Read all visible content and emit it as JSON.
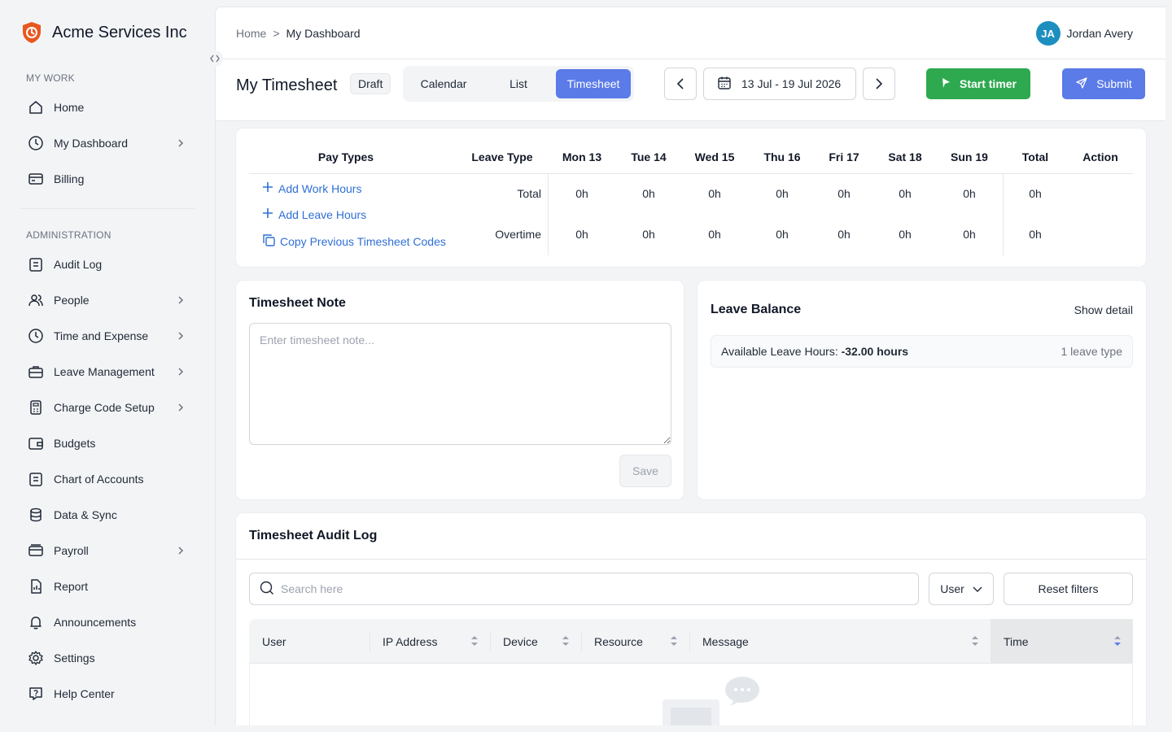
{
  "brand": {
    "name": "Acme Services Inc"
  },
  "sidebar": {
    "sections": [
      {
        "title": "MY WORK"
      },
      {
        "title": "ADMINISTRATION"
      }
    ],
    "items": [
      {
        "label": "Home"
      },
      {
        "label": "My Dashboard"
      },
      {
        "label": "Billing"
      },
      {
        "label": "Audit Log"
      },
      {
        "label": "People"
      },
      {
        "label": "Time and Expense"
      },
      {
        "label": "Leave Management"
      },
      {
        "label": "Charge Code Setup"
      },
      {
        "label": "Budgets"
      },
      {
        "label": "Chart of Accounts"
      },
      {
        "label": "Data & Sync"
      },
      {
        "label": "Payroll"
      },
      {
        "label": "Report"
      },
      {
        "label": "Announcements"
      },
      {
        "label": "Settings"
      },
      {
        "label": "Help Center"
      }
    ]
  },
  "breadcrumb": {
    "home": "Home",
    "separator": ">",
    "current": "My Dashboard"
  },
  "user": {
    "initials": "JA",
    "name": "Jordan Avery"
  },
  "toolbar": {
    "title": "My Timesheet",
    "status": "Draft",
    "views": [
      "Calendar",
      "List",
      "Timesheet"
    ],
    "active_view": "Timesheet",
    "date_range": "13 Jul - 19 Jul 2026",
    "start_timer": "Start timer",
    "submit": "Submit"
  },
  "timesheet": {
    "headers": {
      "pay_types": "Pay Types",
      "leave_type": "Leave Type",
      "days": [
        "Mon 13",
        "Tue 14",
        "Wed 15",
        "Thu 16",
        "Fri 17",
        "Sat 18",
        "Sun 19"
      ],
      "total": "Total",
      "action": "Action"
    },
    "links": {
      "add_work": "Add Work Hours",
      "add_leave": "Add Leave Hours",
      "copy_prev": "Copy Previous Timesheet Codes"
    },
    "rows": [
      {
        "label": "Total",
        "values": [
          "0h",
          "0h",
          "0h",
          "0h",
          "0h",
          "0h",
          "0h"
        ],
        "total": "0h"
      },
      {
        "label": "Overtime",
        "values": [
          "0h",
          "0h",
          "0h",
          "0h",
          "0h",
          "0h",
          "0h"
        ],
        "total": "0h"
      }
    ]
  },
  "note": {
    "title": "Timesheet Note",
    "placeholder": "Enter timesheet note...",
    "save": "Save"
  },
  "leave": {
    "title": "Leave Balance",
    "show_detail": "Show detail",
    "available_label": "Available Leave Hours:",
    "available_value": "-32.00 hours",
    "types": "1 leave type"
  },
  "audit": {
    "title": "Timesheet Audit Log",
    "search_placeholder": "Search here",
    "user_filter": "User",
    "reset": "Reset filters",
    "columns": [
      "User",
      "IP Address",
      "Device",
      "Resource",
      "Message",
      "Time"
    ]
  },
  "colors": {
    "accent": "#5a7be8",
    "success": "#2ea94f",
    "link": "#2f6fd6",
    "brand": "#e8571f"
  }
}
